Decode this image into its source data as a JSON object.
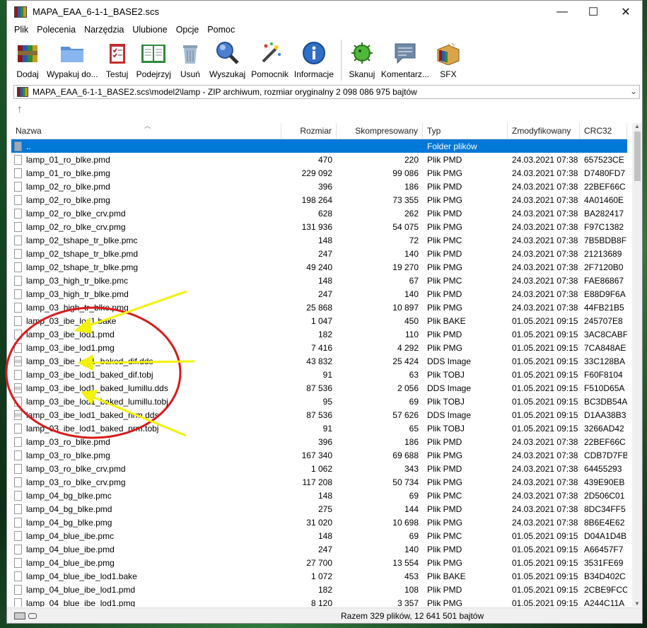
{
  "window": {
    "title": "MAPA_EAA_6-1-1_BASE2.scs",
    "controls": {
      "minimize": "—",
      "maximize": "☐",
      "close": "✕"
    }
  },
  "menu": [
    "Plik",
    "Polecenia",
    "Narzędzia",
    "Ulubione",
    "Opcje",
    "Pomoc"
  ],
  "toolbar": [
    {
      "label": "Dodaj",
      "icon": "add-archive-icon"
    },
    {
      "label": "Wypakuj do...",
      "icon": "extract-folder-icon"
    },
    {
      "label": "Testuj",
      "icon": "test-clipboard-icon"
    },
    {
      "label": "Podejrzyj",
      "icon": "view-book-icon"
    },
    {
      "label": "Usuń",
      "icon": "trash-icon"
    },
    {
      "label": "Wyszukaj",
      "icon": "magnifier-icon"
    },
    {
      "label": "Pomocnik",
      "icon": "wizard-wand-icon"
    },
    {
      "label": "Informacje",
      "icon": "info-icon"
    },
    {
      "label": "Skanuj",
      "icon": "virus-scan-icon"
    },
    {
      "label": "Komentarz...",
      "icon": "comment-icon"
    },
    {
      "label": "SFX",
      "icon": "sfx-box-icon"
    }
  ],
  "address": "MAPA_EAA_6-1-1_BASE2.scs\\model2\\lamp - ZIP archiwum, rozmiar oryginalny 2 098 086 975 bajtów",
  "columns": [
    "Nazwa",
    "Rozmiar",
    "Skompresowany",
    "Typ",
    "Zmodyfikowany",
    "CRC32"
  ],
  "rows": [
    {
      "name": "..",
      "size": "",
      "comp": "",
      "type": "Folder plików",
      "mod": "",
      "crc": "",
      "kind": "folder",
      "selected": true
    },
    {
      "name": "lamp_01_ro_blke.pmd",
      "size": "470",
      "comp": "220",
      "type": "Plik PMD",
      "mod": "24.03.2021 07:38",
      "crc": "657523CE",
      "kind": "file"
    },
    {
      "name": "lamp_01_ro_blke.pmg",
      "size": "229 092",
      "comp": "99 086",
      "type": "Plik PMG",
      "mod": "24.03.2021 07:38",
      "crc": "D7480FD7",
      "kind": "file"
    },
    {
      "name": "lamp_02_ro_blke.pmd",
      "size": "396",
      "comp": "186",
      "type": "Plik PMD",
      "mod": "24.03.2021 07:38",
      "crc": "22BEF66C",
      "kind": "file"
    },
    {
      "name": "lamp_02_ro_blke.pmg",
      "size": "198 264",
      "comp": "73 355",
      "type": "Plik PMG",
      "mod": "24.03.2021 07:38",
      "crc": "4A01460E",
      "kind": "file"
    },
    {
      "name": "lamp_02_ro_blke_crv.pmd",
      "size": "628",
      "comp": "262",
      "type": "Plik PMD",
      "mod": "24.03.2021 07:38",
      "crc": "BA282417",
      "kind": "file"
    },
    {
      "name": "lamp_02_ro_blke_crv.pmg",
      "size": "131 936",
      "comp": "54 075",
      "type": "Plik PMG",
      "mod": "24.03.2021 07:38",
      "crc": "F97C1382",
      "kind": "file"
    },
    {
      "name": "lamp_02_tshape_tr_blke.pmc",
      "size": "148",
      "comp": "72",
      "type": "Plik PMC",
      "mod": "24.03.2021 07:38",
      "crc": "7B5BDB8F",
      "kind": "file"
    },
    {
      "name": "lamp_02_tshape_tr_blke.pmd",
      "size": "247",
      "comp": "140",
      "type": "Plik PMD",
      "mod": "24.03.2021 07:38",
      "crc": "21213689",
      "kind": "file"
    },
    {
      "name": "lamp_02_tshape_tr_blke.pmg",
      "size": "49 240",
      "comp": "19 270",
      "type": "Plik PMG",
      "mod": "24.03.2021 07:38",
      "crc": "2F7120B0",
      "kind": "file"
    },
    {
      "name": "lamp_03_high_tr_blke.pmc",
      "size": "148",
      "comp": "67",
      "type": "Plik PMC",
      "mod": "24.03.2021 07:38",
      "crc": "FAE86867",
      "kind": "file"
    },
    {
      "name": "lamp_03_high_tr_blke.pmd",
      "size": "247",
      "comp": "140",
      "type": "Plik PMD",
      "mod": "24.03.2021 07:38",
      "crc": "E88D9F6A",
      "kind": "file"
    },
    {
      "name": "lamp_03_high_tr_blke.pmg",
      "size": "25 868",
      "comp": "10 897",
      "type": "Plik PMG",
      "mod": "24.03.2021 07:38",
      "crc": "44FB21B5",
      "kind": "file"
    },
    {
      "name": "lamp_03_ibe_lod1.bake",
      "size": "1 047",
      "comp": "450",
      "type": "Plik BAKE",
      "mod": "01.05.2021 09:15",
      "crc": "245707E8",
      "kind": "file"
    },
    {
      "name": "lamp_03_ibe_lod1.pmd",
      "size": "182",
      "comp": "110",
      "type": "Plik PMD",
      "mod": "01.05.2021 09:15",
      "crc": "3AC8CABF",
      "kind": "file"
    },
    {
      "name": "lamp_03_ibe_lod1.pmg",
      "size": "7 416",
      "comp": "4 292",
      "type": "Plik PMG",
      "mod": "01.05.2021 09:15",
      "crc": "7CA848AE",
      "kind": "file"
    },
    {
      "name": "lamp_03_ibe_lod1_baked_dif.dds",
      "size": "43 832",
      "comp": "25 424",
      "type": "DDS Image",
      "mod": "01.05.2021 09:15",
      "crc": "33C128BA",
      "kind": "img"
    },
    {
      "name": "lamp_03_ibe_lod1_baked_dif.tobj",
      "size": "91",
      "comp": "63",
      "type": "Plik TOBJ",
      "mod": "01.05.2021 09:15",
      "crc": "F60F8104",
      "kind": "file"
    },
    {
      "name": "lamp_03_ibe_lod1_baked_lumillu.dds",
      "size": "87 536",
      "comp": "2 056",
      "type": "DDS Image",
      "mod": "01.05.2021 09:15",
      "crc": "F510D65A",
      "kind": "img"
    },
    {
      "name": "lamp_03_ibe_lod1_baked_lumillu.tobj",
      "size": "95",
      "comp": "69",
      "type": "Plik TOBJ",
      "mod": "01.05.2021 09:15",
      "crc": "BC3DB54A",
      "kind": "file"
    },
    {
      "name": "lamp_03_ibe_lod1_baked_nrm.dds",
      "size": "87 536",
      "comp": "57 626",
      "type": "DDS Image",
      "mod": "01.05.2021 09:15",
      "crc": "D1AA38B3",
      "kind": "img"
    },
    {
      "name": "lamp_03_ibe_lod1_baked_nrm.tobj",
      "size": "91",
      "comp": "65",
      "type": "Plik TOBJ",
      "mod": "01.05.2021 09:15",
      "crc": "3266AD42",
      "kind": "file"
    },
    {
      "name": "lamp_03_ro_blke.pmd",
      "size": "396",
      "comp": "186",
      "type": "Plik PMD",
      "mod": "24.03.2021 07:38",
      "crc": "22BEF66C",
      "kind": "file"
    },
    {
      "name": "lamp_03_ro_blke.pmg",
      "size": "167 340",
      "comp": "69 688",
      "type": "Plik PMG",
      "mod": "24.03.2021 07:38",
      "crc": "CDB7D7FB",
      "kind": "file"
    },
    {
      "name": "lamp_03_ro_blke_crv.pmd",
      "size": "1 062",
      "comp": "343",
      "type": "Plik PMD",
      "mod": "24.03.2021 07:38",
      "crc": "64455293",
      "kind": "file"
    },
    {
      "name": "lamp_03_ro_blke_crv.pmg",
      "size": "117 208",
      "comp": "50 734",
      "type": "Plik PMG",
      "mod": "24.03.2021 07:38",
      "crc": "439E90EB",
      "kind": "file"
    },
    {
      "name": "lamp_04_bg_blke.pmc",
      "size": "148",
      "comp": "69",
      "type": "Plik PMC",
      "mod": "24.03.2021 07:38",
      "crc": "2D506C01",
      "kind": "file"
    },
    {
      "name": "lamp_04_bg_blke.pmd",
      "size": "275",
      "comp": "144",
      "type": "Plik PMD",
      "mod": "24.03.2021 07:38",
      "crc": "8DC34FF5",
      "kind": "file"
    },
    {
      "name": "lamp_04_bg_blke.pmg",
      "size": "31 020",
      "comp": "10 698",
      "type": "Plik PMG",
      "mod": "24.03.2021 07:38",
      "crc": "8B6E4E62",
      "kind": "file"
    },
    {
      "name": "lamp_04_blue_ibe.pmc",
      "size": "148",
      "comp": "69",
      "type": "Plik PMC",
      "mod": "01.05.2021 09:15",
      "crc": "D04A1D4B",
      "kind": "file"
    },
    {
      "name": "lamp_04_blue_ibe.pmd",
      "size": "247",
      "comp": "140",
      "type": "Plik PMD",
      "mod": "01.05.2021 09:15",
      "crc": "A66457F7",
      "kind": "file"
    },
    {
      "name": "lamp_04_blue_ibe.pmg",
      "size": "27 700",
      "comp": "13 554",
      "type": "Plik PMG",
      "mod": "01.05.2021 09:15",
      "crc": "3531FE69",
      "kind": "file"
    },
    {
      "name": "lamp_04_blue_ibe_lod1.bake",
      "size": "1 072",
      "comp": "453",
      "type": "Plik BAKE",
      "mod": "01.05.2021 09:15",
      "crc": "B34D402C",
      "kind": "file"
    },
    {
      "name": "lamp_04_blue_ibe_lod1.pmd",
      "size": "182",
      "comp": "108",
      "type": "Plik PMD",
      "mod": "01.05.2021 09:15",
      "crc": "2CBE9FCC",
      "kind": "file"
    },
    {
      "name": "lamp_04_blue_ibe_lod1.pmg",
      "size": "8 120",
      "comp": "3 357",
      "type": "Plik PMG",
      "mod": "01.05.2021 09:15",
      "crc": "A244C11A",
      "kind": "file"
    }
  ],
  "status": "Razem 329 plików, 12 641 501 bajtów",
  "colors": {
    "selection": "#0078d7",
    "annotation_red": "#d81b1b",
    "annotation_yellow": "#f2f20a"
  }
}
